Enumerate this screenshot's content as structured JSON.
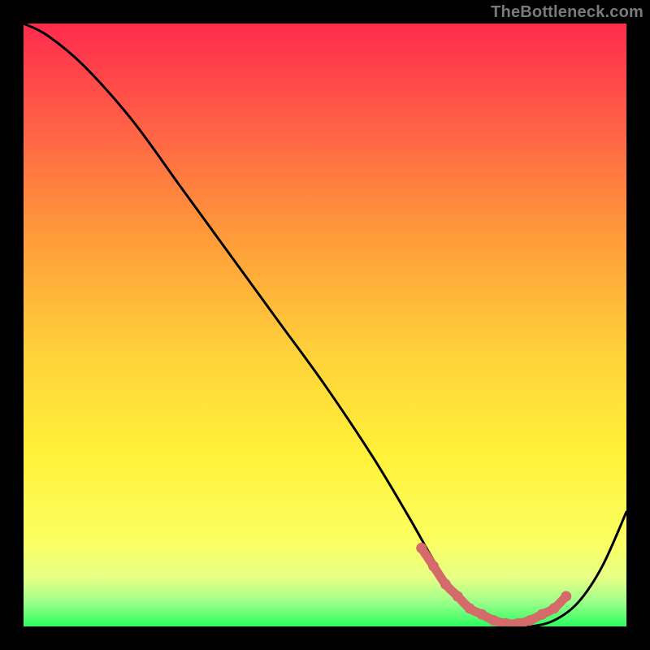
{
  "watermark": {
    "text": "TheBottleneck.com"
  },
  "gradient": {
    "stops": [
      {
        "offset": 0.0,
        "color": "#ff2b4d"
      },
      {
        "offset": 0.15,
        "color": "#ff5a47"
      },
      {
        "offset": 0.35,
        "color": "#ff9a3a"
      },
      {
        "offset": 0.55,
        "color": "#ffd23a"
      },
      {
        "offset": 0.72,
        "color": "#fff23a"
      },
      {
        "offset": 0.86,
        "color": "#fbff62"
      },
      {
        "offset": 0.92,
        "color": "#e6ff86"
      },
      {
        "offset": 0.96,
        "color": "#9bff8a"
      },
      {
        "offset": 1.0,
        "color": "#2bff5e"
      }
    ]
  },
  "chart_data": {
    "type": "line",
    "title": "",
    "xlabel": "",
    "ylabel": "",
    "xlim": [
      0,
      100
    ],
    "ylim": [
      0,
      100
    ],
    "series": [
      {
        "name": "bottleneck-curve",
        "x": [
          0,
          4,
          10,
          18,
          26,
          34,
          42,
          50,
          58,
          64,
          68,
          72,
          76,
          80,
          84,
          88,
          92,
          96,
          100
        ],
        "values": [
          100,
          98,
          93,
          84,
          73,
          62,
          51,
          40,
          28,
          18,
          11,
          5,
          2,
          0,
          0,
          1,
          4,
          10,
          19
        ]
      }
    ],
    "highlight": {
      "name": "minimum-band",
      "x": [
        66,
        68,
        70,
        72,
        74,
        76,
        78,
        80,
        82,
        84,
        86,
        88,
        90
      ],
      "values": [
        13,
        10,
        7,
        5,
        3,
        2,
        1,
        0.5,
        0.5,
        1,
        2,
        3,
        5
      ]
    }
  }
}
